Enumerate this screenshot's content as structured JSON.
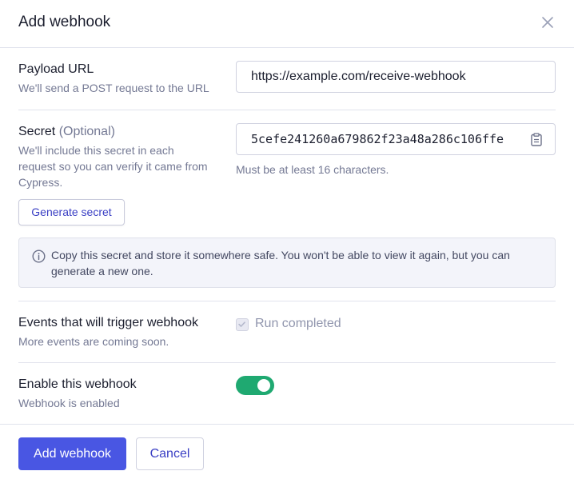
{
  "modal": {
    "title": "Add webhook",
    "close_icon": "close-icon"
  },
  "payload_url": {
    "label": "Payload URL",
    "help": "We'll send a POST request to the URL",
    "value": "https://example.com/receive-webhook"
  },
  "secret": {
    "label": "Secret",
    "optional": "(Optional)",
    "help_lines": [
      "We'll include this secret in each",
      "request so you can verify it came from",
      "Cypress."
    ],
    "value": "5cefe241260a679862f23a48a286c106ffe",
    "copy_icon": "clipboard-icon",
    "hint": "Must be at least 16 characters.",
    "generate_label": "Generate secret"
  },
  "alert": {
    "icon": "info-icon",
    "lines": [
      "Copy this secret and store it somewhere safe. You won't be able to view it again, but you can",
      "generate a new one."
    ]
  },
  "events": {
    "label": "Events that will trigger webhook",
    "help": "More events are coming soon.",
    "option_label": "Run completed",
    "option_checked": true
  },
  "enable": {
    "label": "Enable this webhook",
    "help": "Webhook is enabled",
    "enabled": true
  },
  "footer": {
    "primary_label": "Add webhook",
    "cancel_label": "Cancel"
  },
  "colors": {
    "primary": "#4956e3",
    "link": "#3a3fc4",
    "toggle_on": "#1fa971"
  }
}
